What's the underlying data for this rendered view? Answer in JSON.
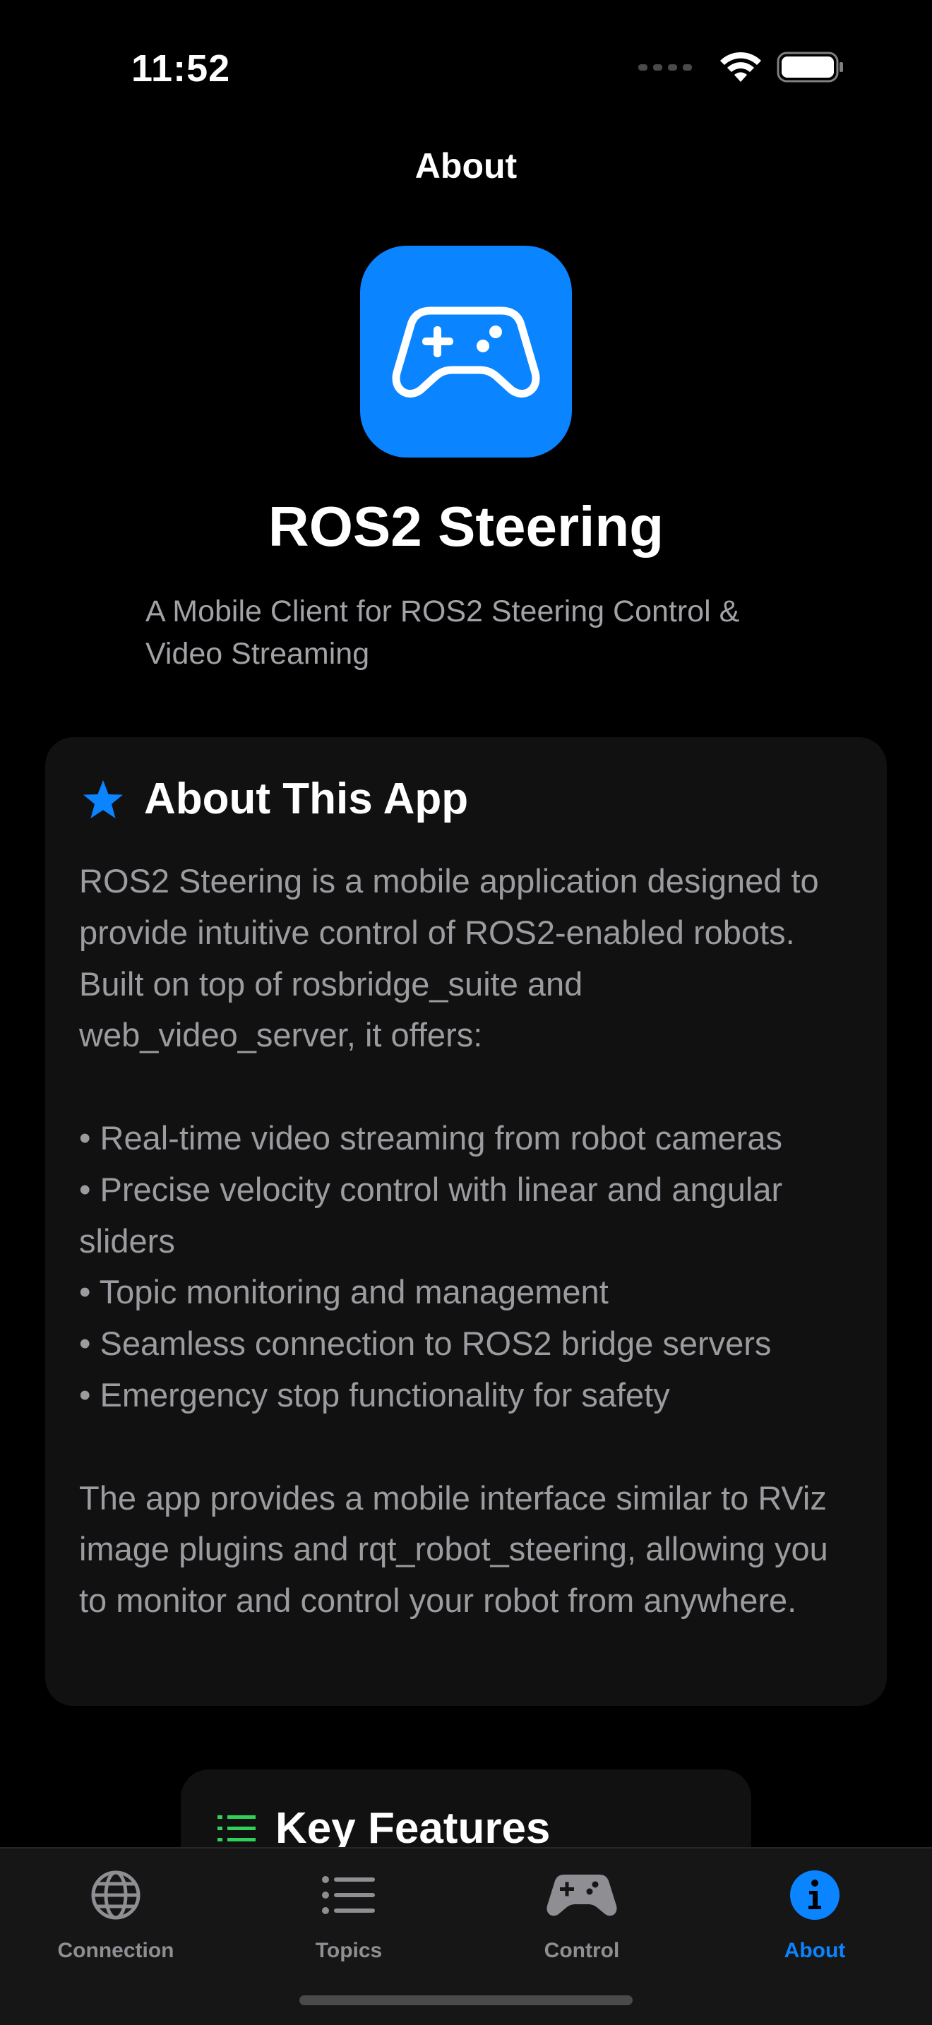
{
  "status_bar": {
    "time": "11:52"
  },
  "nav": {
    "title": "About"
  },
  "app": {
    "name": "ROS2 Steering",
    "tagline": "A Mobile Client for ROS2 Steering Control & Video Streaming",
    "icon": "gamecontroller-icon",
    "icon_bg_color": "#0a84ff"
  },
  "about_card": {
    "icon": "star-icon",
    "title": "About This App",
    "body": "ROS2 Steering is a mobile application designed to provide intuitive control of ROS2-enabled robots. Built on top of rosbridge_suite and web_video_server, it offers:\n\n• Real-time video streaming from robot cameras\n• Precise velocity control with linear and angular sliders\n• Topic monitoring and management\n• Seamless connection to ROS2 bridge servers\n• Emergency stop functionality for safety\n\nThe app provides a mobile interface similar to RViz image plugins and rqt_robot_steering, allowing you to monitor and control your robot from anywhere."
  },
  "features_card": {
    "icon": "list-icon",
    "title": "Key Features"
  },
  "tabs": [
    {
      "label": "Connection",
      "icon": "globe-icon",
      "active": false
    },
    {
      "label": "Topics",
      "icon": "list-bullet-icon",
      "active": false
    },
    {
      "label": "Control",
      "icon": "gamecontroller-icon",
      "active": false
    },
    {
      "label": "About",
      "icon": "info-icon",
      "active": true
    }
  ],
  "colors": {
    "accent": "#0a84ff",
    "features_icon": "#30d158",
    "background": "#000000",
    "card": "#111111"
  }
}
